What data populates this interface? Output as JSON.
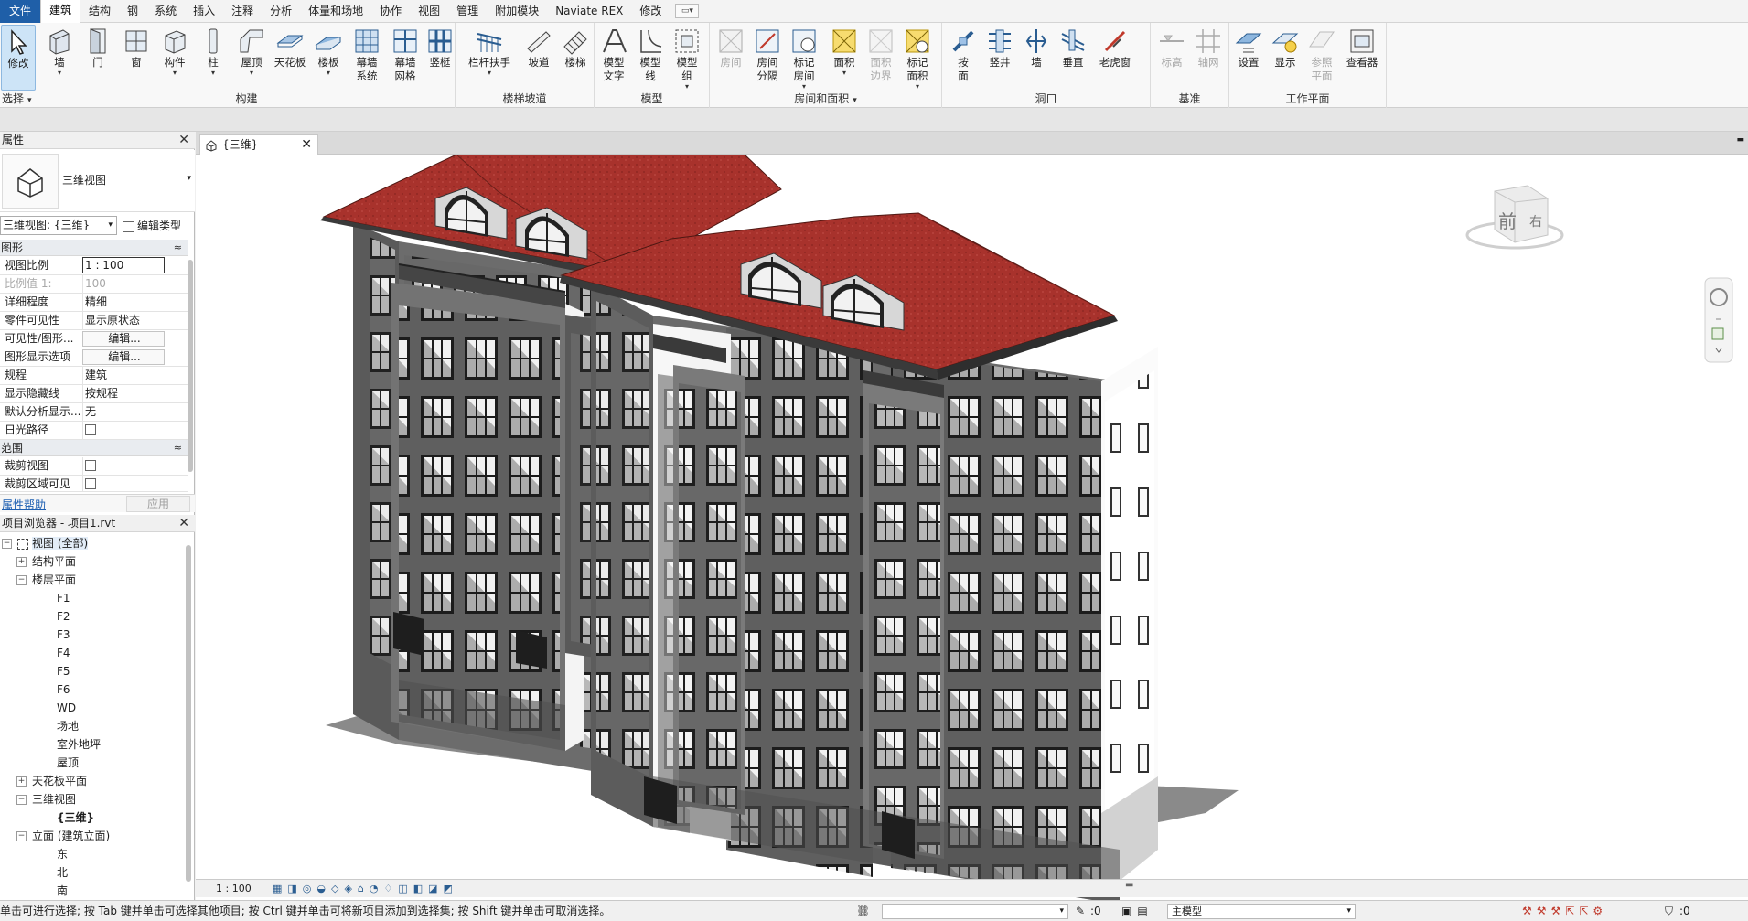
{
  "menu": {
    "items": [
      "文件",
      "建筑",
      "结构",
      "钢",
      "系统",
      "插入",
      "注释",
      "分析",
      "体量和场地",
      "协作",
      "视图",
      "管理",
      "附加模块",
      "Naviate REX",
      "修改"
    ],
    "active_index": 1
  },
  "ribbon": {
    "select": {
      "tool": "修改",
      "group_label": "选择"
    },
    "build": {
      "group_label": "构建",
      "tools": [
        "墙",
        "门",
        "窗",
        "构件",
        "柱",
        "屋顶",
        "天花板",
        "楼板",
        "幕墙\n系统",
        "幕墙\n网格",
        "竖梃"
      ]
    },
    "circulation": {
      "group_label": "楼梯坡道",
      "tools": [
        "栏杆扶手",
        "坡道",
        "楼梯"
      ]
    },
    "model": {
      "group_label": "模型",
      "tools": [
        "模型\n文字",
        "模型\n线",
        "模型\n组"
      ]
    },
    "room": {
      "group_label": "房间和面积",
      "tools": [
        "房间",
        "房间\n分隔",
        "标记\n房间",
        "面积",
        "面积\n边界",
        "标记\n面积"
      ]
    },
    "opening": {
      "group_label": "洞口",
      "tools": [
        "按\n面",
        "竖井",
        "墙",
        "垂直",
        "老虎窗"
      ]
    },
    "datum": {
      "group_label": "基准",
      "tools": [
        "标高",
        "轴网"
      ]
    },
    "workplane": {
      "group_label": "工作平面",
      "tools": [
        "设置",
        "显示",
        "参照\n平面",
        "查看器"
      ]
    }
  },
  "properties": {
    "title": "属性",
    "type_name": "三维视图",
    "view_selector": "三维视图: {三维}",
    "edit_type": "编辑类型",
    "sections": {
      "graphics": "图形",
      "extents": "范围"
    },
    "rows": [
      {
        "key": "视图比例",
        "value": "1 : 100"
      },
      {
        "key": "比例值 1:",
        "value": "100"
      },
      {
        "key": "详细程度",
        "value": "精细"
      },
      {
        "key": "零件可见性",
        "value": "显示原状态"
      },
      {
        "key": "可见性/图形...",
        "value": "编辑..."
      },
      {
        "key": "图形显示选项",
        "value": "编辑..."
      },
      {
        "key": "规程",
        "value": "建筑"
      },
      {
        "key": "显示隐藏线",
        "value": "按规程"
      },
      {
        "key": "默认分析显示...",
        "value": "无"
      },
      {
        "key": "日光路径",
        "value": ""
      }
    ],
    "extent_rows": [
      {
        "key": "裁剪视图"
      },
      {
        "key": "裁剪区域可见"
      }
    ],
    "help_link": "属性帮助",
    "apply": "应用"
  },
  "browser": {
    "title": "项目浏览器 - 项目1.rvt",
    "root": "视图 (全部)",
    "nodes": [
      "结构平面",
      "楼层平面",
      "F1",
      "F2",
      "F3",
      "F4",
      "F5",
      "F6",
      "WD",
      "场地",
      "室外地坪",
      "屋顶",
      "天花板平面",
      "三维视图",
      "{三维}",
      "立面 (建筑立面)",
      "东",
      "北",
      "南"
    ]
  },
  "view": {
    "tab": "{三维}",
    "scale": "1 : 100",
    "viewcube": {
      "front": "前",
      "right": "右"
    }
  },
  "status": {
    "hint": "单击可进行选择; 按 Tab 键并单击可选择其他项目; 按 Ctrl 键并单击可将新项目添加到选择集; 按 Shift 键并单击可取消选择。",
    "sel_count": ":0",
    "model": "主模型",
    "filter_count": ":0"
  },
  "colors": {
    "roof": "#a8322c",
    "wall": "#6e6e6e",
    "accent": "#1f5fa8"
  }
}
